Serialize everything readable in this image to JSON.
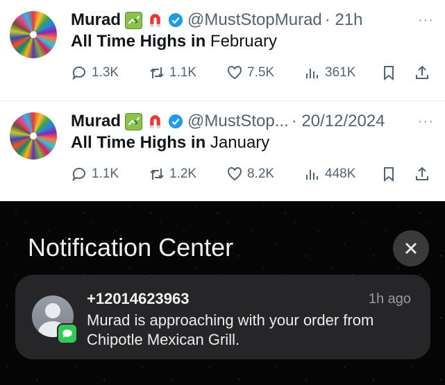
{
  "tweets": [
    {
      "name": "Murad",
      "handle": "@MustStopMurad",
      "time": "· 21h",
      "more": "···",
      "text_bold": "All Time Highs in",
      "text_rest": " February",
      "replies": "1.3K",
      "reposts": "1.1K",
      "likes": "7.5K",
      "views": "361K"
    },
    {
      "name": "Murad",
      "handle": "@MustStop...",
      "time": "· 20/12/2024",
      "more": "···",
      "text_bold": "All Time Highs in",
      "text_rest": " January",
      "replies": "1.1K",
      "reposts": "1.2K",
      "likes": "8.2K",
      "views": "448K"
    }
  ],
  "notification_center": {
    "title": "Notification Center",
    "notification": {
      "sender": "+12014623963",
      "time": "1h ago",
      "body": "Murad is approaching with your order from Chipotle Mexican Grill."
    }
  },
  "colors": {
    "verified": "#1d9bf0",
    "notif_bg": "#050505",
    "card_bg": "#262628",
    "messages_green": "#34c759"
  }
}
